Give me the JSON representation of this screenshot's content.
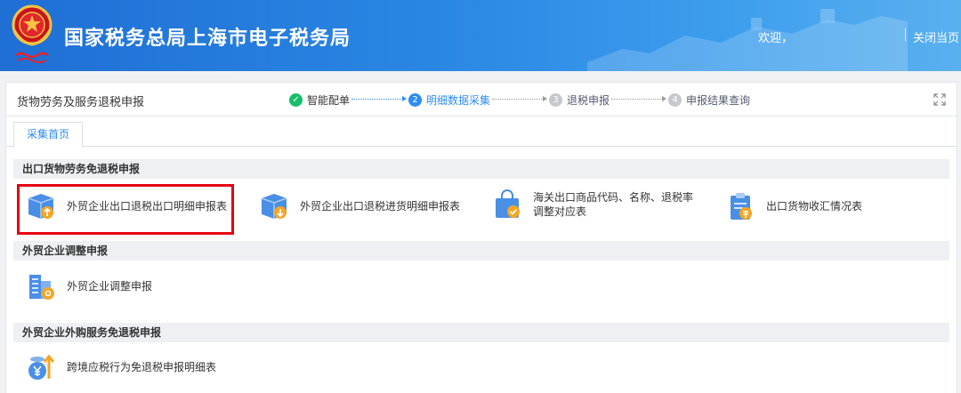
{
  "header": {
    "site_title": "国家税务总局上海市电子税务局",
    "welcome": "欢迎，",
    "close_label": "关闭当页",
    "colors": {
      "bar_start": "#1f6fd4",
      "bar_end": "#5ab0ef"
    }
  },
  "panel": {
    "title": "货物劳务及服务退税申报",
    "steps": [
      {
        "num": "✓",
        "label": "智能配单",
        "state": "done"
      },
      {
        "num": "2",
        "label": "明细数据采集",
        "state": "active"
      },
      {
        "num": "3",
        "label": "退税申报",
        "state": "todo"
      },
      {
        "num": "4",
        "label": "申报结果查询",
        "state": "todo"
      }
    ],
    "expand_icon": "fullscreen-icon"
  },
  "tabs": [
    {
      "label": "采集首页",
      "active": true
    }
  ],
  "sections": [
    {
      "title": "出口货物劳务免退税申报",
      "items": [
        {
          "label": "外贸企业出口退税出口明细申报表",
          "icon": "box-upload-icon",
          "highlighted": true
        },
        {
          "label": "外贸企业出口退税进货明细申报表",
          "icon": "box-download-icon"
        },
        {
          "label": "海关出口商品代码、名称、退税率调整对应表",
          "icon": "shopping-bag-check-icon"
        },
        {
          "label": "出口货物收汇情况表",
          "icon": "clipboard-money-icon"
        }
      ]
    },
    {
      "title": "外贸企业调整申报",
      "items": [
        {
          "label": "外贸企业调整申报",
          "icon": "buildings-gear-icon"
        }
      ]
    },
    {
      "title": "外贸企业外购服务免退税申报",
      "items": [
        {
          "label": "跨境应税行为免退税申报明细表",
          "icon": "coins-arrow-icon"
        }
      ]
    }
  ],
  "accent_colors": {
    "primary": "#2d8cf0",
    "success": "#19be6b",
    "highlight": "#e60012",
    "icon_orange": "#f5a623"
  }
}
